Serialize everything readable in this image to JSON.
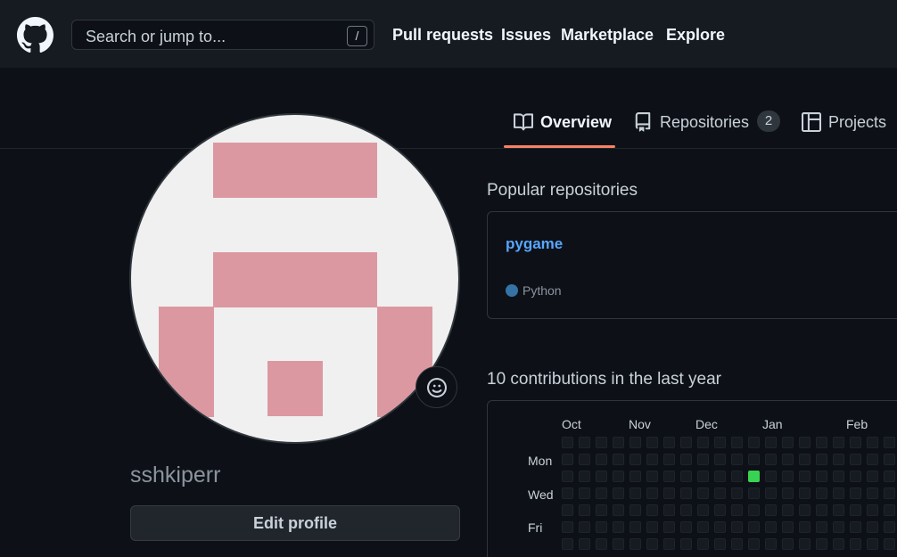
{
  "header": {
    "search_placeholder": "Search or jump to...",
    "search_shortcut": "/",
    "nav": [
      "Pull requests",
      "Issues",
      "Marketplace",
      "Explore"
    ]
  },
  "tabs": [
    {
      "label": "Overview",
      "icon": "book-icon",
      "active": true
    },
    {
      "label": "Repositories",
      "icon": "repo-icon",
      "count": "2"
    },
    {
      "label": "Projects",
      "icon": "table-icon"
    }
  ],
  "profile": {
    "username": "sshkiperr",
    "edit_label": "Edit profile",
    "status_icon": "smiley-icon",
    "avatar_colors": {
      "background": "#f0f0f0",
      "pixels": "#dc98a1"
    }
  },
  "popular": {
    "title": "Popular repositories",
    "repos": [
      {
        "name": "pygame",
        "language": "Python",
        "language_color": "#3572a5"
      }
    ]
  },
  "contributions": {
    "title": "10 contributions in the last year",
    "months": [
      "Oct",
      "Nov",
      "Dec",
      "Jan",
      "Feb"
    ],
    "day_labels": [
      "Mon",
      "Wed",
      "Fri"
    ],
    "colors": {
      "empty": "#161b22",
      "active": "#39d353"
    },
    "active_day": {
      "week": 11,
      "weekday": 2
    }
  }
}
